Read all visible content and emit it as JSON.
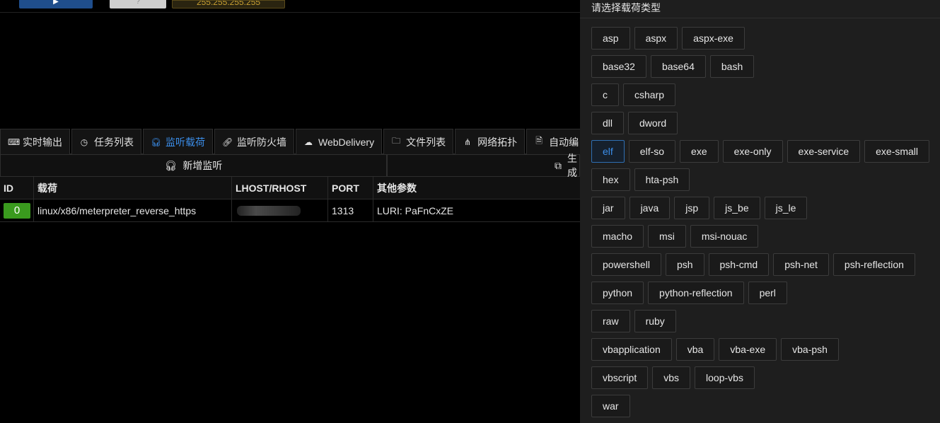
{
  "topbar": {
    "play_label": "▶",
    "help_label": "?",
    "ip_label": "255.255.255.255"
  },
  "tabs": [
    {
      "label": "实时输出",
      "icon": "terminal-icon",
      "active": false
    },
    {
      "label": "任务列表",
      "icon": "clock-icon",
      "active": false
    },
    {
      "label": "监听载荷",
      "icon": "headset-icon",
      "active": true
    },
    {
      "label": "监听防火墙",
      "icon": "link-icon",
      "active": false
    },
    {
      "label": "WebDelivery",
      "icon": "cloud-icon",
      "active": false
    },
    {
      "label": "文件列表",
      "icon": "folder-icon",
      "active": false
    },
    {
      "label": "网络拓扑",
      "icon": "network-icon",
      "active": false
    },
    {
      "label": "自动编",
      "icon": "document-icon",
      "active": false
    }
  ],
  "subbar": {
    "add_listener_label": "新增监听",
    "generate_label": "生成"
  },
  "table": {
    "headers": [
      "ID",
      "载荷",
      "LHOST/RHOST",
      "PORT",
      "其他参数"
    ],
    "rows": [
      {
        "id": "0",
        "payload": "linux/x86/meterpreter_reverse_https",
        "host": "",
        "port": "1313",
        "other": "LURI: PaFnCxZE"
      }
    ]
  },
  "panel": {
    "title": "请选择载荷类型",
    "selected": "elf",
    "rows": [
      [
        "asp",
        "aspx",
        "aspx-exe"
      ],
      [
        "base32",
        "base64",
        "bash"
      ],
      [
        "c",
        "csharp"
      ],
      [
        "dll",
        "dword"
      ],
      [
        "elf",
        "elf-so",
        "exe",
        "exe-only",
        "exe-service",
        "exe-small"
      ],
      [
        "hex",
        "hta-psh"
      ],
      [
        "jar",
        "java",
        "jsp",
        "js_be",
        "js_le"
      ],
      [
        "macho",
        "msi",
        "msi-nouac"
      ],
      [
        "powershell",
        "psh",
        "psh-cmd",
        "psh-net",
        "psh-reflection"
      ],
      [
        "python",
        "python-reflection",
        "perl"
      ],
      [
        "raw",
        "ruby"
      ],
      [
        "vbapplication",
        "vba",
        "vba-exe",
        "vba-psh"
      ],
      [
        "vbscript",
        "vbs",
        "loop-vbs"
      ],
      [
        "war"
      ]
    ]
  },
  "colors": {
    "accent": "#3b8eea",
    "id_badge": "#3a9a1e",
    "background": "#000000",
    "panel": "#1e1e1e"
  }
}
